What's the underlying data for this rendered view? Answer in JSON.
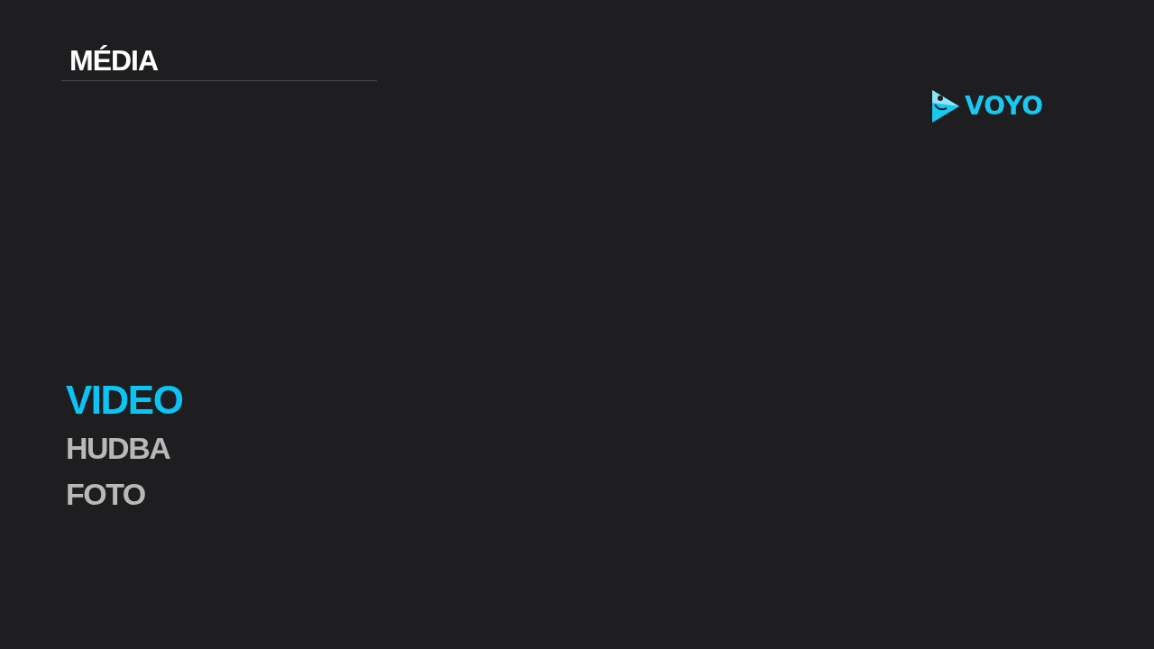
{
  "header": {
    "title": "MÉDIA"
  },
  "logo": {
    "text": "VOYO"
  },
  "menu": [
    {
      "label": "VIDEO",
      "selected": true
    },
    {
      "label": "HUDBA",
      "selected": false
    },
    {
      "label": "FOTO",
      "selected": false
    }
  ]
}
